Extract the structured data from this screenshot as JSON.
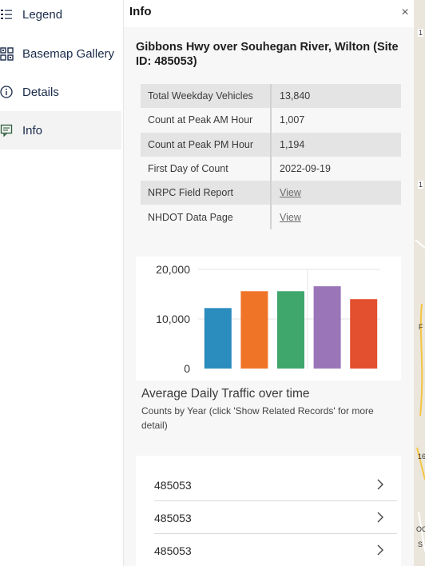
{
  "nav": {
    "items": [
      {
        "label": "Legend",
        "icon": "legend-icon"
      },
      {
        "label": "Basemap Gallery",
        "icon": "basemap-gallery-icon"
      },
      {
        "label": "Details",
        "icon": "info-circle-icon"
      },
      {
        "label": "Info",
        "icon": "popup-icon",
        "active": true
      }
    ]
  },
  "panel": {
    "title": "Info",
    "close_label": "×",
    "site_title": "Gibbons Hwy over Souhegan River, Wilton (Site ID: 485053)",
    "attributes": [
      {
        "key": "Total Weekday Vehicles",
        "value": "13,840"
      },
      {
        "key": "Count at Peak AM Hour",
        "value": "1,007"
      },
      {
        "key": "Count at Peak PM Hour",
        "value": "1,194"
      },
      {
        "key": "First Day of Count",
        "value": "2022-09-19"
      },
      {
        "key": "NRPC Field Report",
        "value": "View",
        "link": true
      },
      {
        "key": "NHDOT Data Page",
        "value": "View",
        "link": true
      }
    ],
    "chart_caption": "Average Daily Traffic over time",
    "chart_description": "Counts by Year (click 'Show Related Records' for more detail)",
    "records": [
      {
        "label": "485053"
      },
      {
        "label": "485053"
      },
      {
        "label": "485053"
      }
    ]
  },
  "chart_data": {
    "type": "bar",
    "categories": [
      "",
      "",
      "",
      "",
      ""
    ],
    "values": [
      12200,
      15600,
      15600,
      16600,
      14000
    ],
    "colors": [
      "#2b8cbe",
      "#f07427",
      "#3fa66c",
      "#9a75b8",
      "#e2502f"
    ],
    "ylim": [
      0,
      20000
    ],
    "yticks": [
      "20,000",
      "10,000",
      "0"
    ],
    "ytick_values": [
      20000,
      10000,
      0
    ],
    "grid": true
  },
  "map": {
    "labels": [
      "1",
      "1",
      "F",
      "16",
      "OC",
      "S"
    ]
  }
}
